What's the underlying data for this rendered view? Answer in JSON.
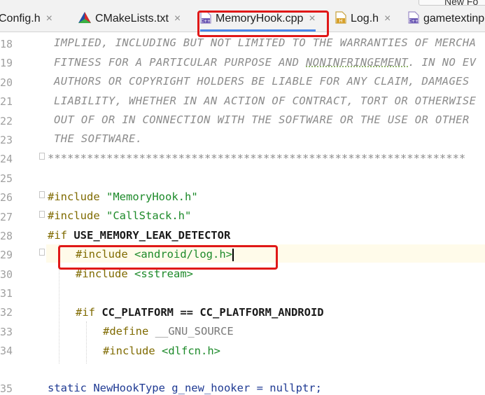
{
  "tabs": [
    {
      "label": "Config.h",
      "close": "×"
    },
    {
      "label": "CMakeLists.txt",
      "close": "×"
    },
    {
      "label": "MemoryHook.cpp",
      "close": "×"
    },
    {
      "label": "Log.h",
      "close": "×"
    },
    {
      "label": "gametextinp"
    }
  ],
  "top_right_button": "New Fo",
  "line_numbers": [
    "18",
    "19",
    "20",
    "21",
    "22",
    "23",
    "24",
    "25",
    "26",
    "27",
    "28",
    "29",
    "30",
    "31",
    "32",
    "33",
    "34",
    "35"
  ],
  "code": {
    "l18": "IMPLIED, INCLUDING BUT NOT LIMITED TO THE WARRANTIES OF MERCHA",
    "l19_a": "FITNESS FOR A PARTICULAR PURPOSE AND ",
    "l19_b": "NONINFRINGEMENT",
    "l19_c": ". IN NO EV",
    "l20": "AUTHORS OR COPYRIGHT HOLDERS BE LIABLE FOR ANY CLAIM, DAMAGES",
    "l21": "LIABILITY, WHETHER IN AN ACTION OF CONTRACT, TORT OR OTHERWISE",
    "l22": "OUT OF OR IN CONNECTION WITH THE SOFTWARE OR THE USE OR OTHER",
    "l23": "THE SOFTWARE.",
    "l24": "****************************************************************",
    "l26_dir": "#include",
    "l26_str": "\"MemoryHook.h\"",
    "l27_dir": "#include",
    "l27_str": "\"CallStack.h\"",
    "l28_dir": "#if",
    "l28_rest": "USE_MEMORY_LEAK_DETECTOR",
    "l29_dir": "#include",
    "l29_str": "<android/log.h>",
    "l30_dir": "#include",
    "l30_str": "<sstream>",
    "l32_dir": "#if",
    "l32_rest": "CC_PLATFORM == CC_PLATFORM_ANDROID",
    "l33_dir": "#define",
    "l33_rest": "__GNU_SOURCE",
    "l34_dir": "#include",
    "l34_str": "<dlfcn.h>",
    "l35": "static NewHookType g_new_hooker = nullptr;"
  }
}
